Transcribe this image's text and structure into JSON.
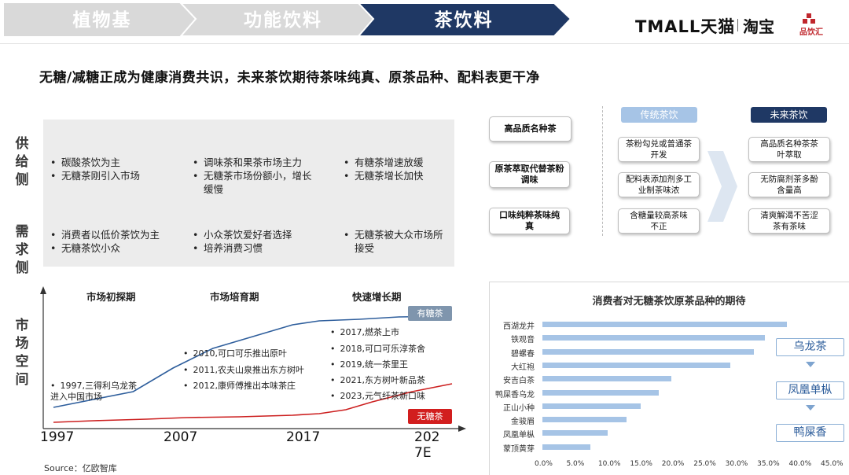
{
  "nav": {
    "tab1": "植物基",
    "tab2": "功能饮料",
    "tab3": "茶饮料",
    "brand_tmall": "TMALL天猫",
    "brand_taobao": "淘宝",
    "brand_pinyin": "品饮汇"
  },
  "headline": "无糖/减糖正成为健康消费共识，未来茶饮期待茶味纯真、原茶品种、配料表更干净",
  "left": {
    "row_labels": [
      "供给侧",
      "需求侧",
      "市场空间"
    ],
    "supply": [
      [
        "碳酸茶饮为主",
        "无糖茶刚引入市场"
      ],
      [
        "调味茶和果茶市场主力",
        "无糖茶市场份额小，增长缓慢"
      ],
      [
        "有糖茶增速放缓",
        "无糖茶增长加快"
      ]
    ],
    "demand": [
      [
        "消费者以低价茶饮为主",
        "无糖茶饮小众"
      ],
      [
        "小众茶饮爱好者选择",
        "培养消费习惯"
      ],
      [
        "无糖茶被大众市场所接受"
      ]
    ],
    "phases": [
      "市场初探期",
      "市场培育期",
      "快速增长期"
    ],
    "first_event": "1997,三得利乌龙茶进入中国市场",
    "events_mid": [
      "2010,可口可乐推出原叶",
      "2011,农夫山泉推出东方树叶",
      "2012,康师傅推出本味茶庄"
    ],
    "events_late": [
      "2017,燃茶上市",
      "2018,可口可乐淳茶舍",
      "2019,统一茶里王",
      "2021,东方树叶新品茶",
      "2023,元气纤茶新口味"
    ],
    "years": [
      "1997",
      "2007",
      "2017",
      "2027E"
    ],
    "sugar_tag": "有糖茶",
    "nosugar_tag": "无糖茶",
    "source": "Source：亿欧智库"
  },
  "right_top": {
    "header_trad": "传统茶饮",
    "header_future": "未来茶饮",
    "left_col": [
      "高品质名种茶",
      "原茶萃取代替茶粉调味",
      "口味纯粹茶味纯真"
    ],
    "trad_col": [
      "茶粉勾兑或普通茶开发",
      "配料表添加剂多工业制茶味浓",
      "含糖量较高茶味不正"
    ],
    "future_col": [
      "高品质名种茶茶叶萃取",
      "无防腐剂茶多酚含量高",
      "清爽解渴不苦涩茶有茶味"
    ]
  },
  "varieties": [
    "乌龙茶",
    "凤凰单枞",
    "鸭屎香"
  ],
  "colors": {
    "nav_active": "#1f3864",
    "nav_inactive": "#d9d9d9",
    "bar": "#a6c4e6",
    "sugar_line": "#2e5e9c",
    "nosugar_line": "#cc1f1f",
    "header": "#a6c4e6",
    "header_dark": "#1f3864"
  },
  "chart_data": {
    "type": "bar",
    "orientation": "horizontal",
    "title": "消费者对无糖茶饮原茶品种的期待",
    "categories": [
      "西湖龙井",
      "铁观音",
      "碧螺春",
      "大红袍",
      "安吉白茶",
      "鸭屎香乌龙",
      "正山小种",
      "金骏眉",
      "凤凰单枞",
      "蒙顶黄芽"
    ],
    "values": [
      38.5,
      35.0,
      33.2,
      29.5,
      20.3,
      18.3,
      15.5,
      13.2,
      10.2,
      7.5
    ],
    "ticks": [
      "0.0%",
      "5.0%",
      "10.0%",
      "15.0%",
      "20.0%",
      "25.0%",
      "30.0%",
      "35.0%",
      "40.0%",
      "45.0%"
    ],
    "xlim": [
      0,
      45
    ],
    "unit": "%"
  },
  "market_chart": {
    "type": "line",
    "x_range": [
      1997,
      2027
    ],
    "series": [
      {
        "name": "有糖茶",
        "x": [
          1997,
          2000,
          2003,
          2006,
          2009,
          2012,
          2015,
          2017,
          2020,
          2023,
          2027
        ],
        "y": [
          0.2,
          0.3,
          0.4,
          0.7,
          0.95,
          1.1,
          1.25,
          1.3,
          1.32,
          1.35,
          1.36
        ]
      },
      {
        "name": "无糖茶",
        "x": [
          1997,
          2000,
          2004,
          2007,
          2011,
          2015,
          2017,
          2019,
          2021,
          2024,
          2027
        ],
        "y": [
          0.01,
          0.03,
          0.05,
          0.07,
          0.08,
          0.1,
          0.12,
          0.17,
          0.27,
          0.4,
          0.5
        ]
      }
    ]
  }
}
